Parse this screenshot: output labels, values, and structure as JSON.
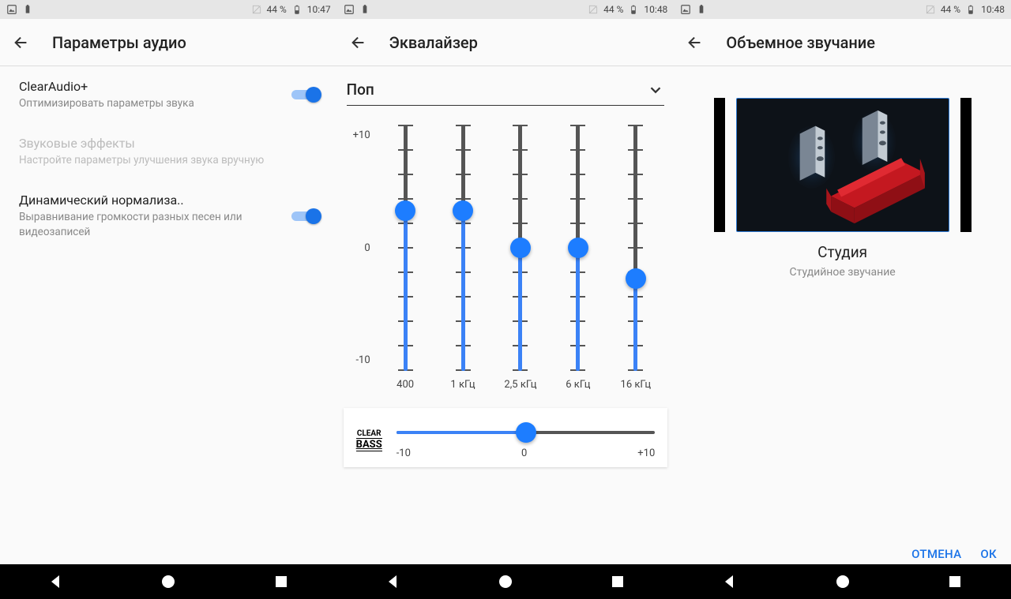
{
  "status": {
    "battery": "44 %",
    "time1": "10:47",
    "time2": "10:48",
    "time3": "10:48"
  },
  "pane1": {
    "title": "Параметры аудио",
    "items": [
      {
        "title": "ClearAudio+",
        "sub": "Оптимизировать параметры звука",
        "switch": true,
        "disabled": false
      },
      {
        "title": "Звуковые эффекты",
        "sub": "Настройте параметры улучшения звука вручную",
        "switch": false,
        "disabled": true
      },
      {
        "title": "Динамический нормализа..",
        "sub": "Выравнивание громкости разных песен или видеозаписей",
        "switch": true,
        "disabled": false
      }
    ]
  },
  "pane2": {
    "title": "Эквалайзер",
    "preset": "Поп",
    "scale": {
      "max": "+10",
      "mid": "0",
      "min": "-10"
    },
    "bands": [
      {
        "freq": "400",
        "value": 3
      },
      {
        "freq": "1 кГц",
        "value": 3
      },
      {
        "freq": "2,5 кГц",
        "value": 0
      },
      {
        "freq": "6 кГц",
        "value": 0
      },
      {
        "freq": "16 кГц",
        "value": -2.5
      }
    ],
    "bass": {
      "label_top": "CLEAR",
      "label_bot": "BASS",
      "value": 0,
      "min": "-10",
      "mid": "0",
      "max": "+10"
    }
  },
  "pane3": {
    "title": "Объемное звучание",
    "option": {
      "name": "Студия",
      "sub": "Студийное звучание"
    },
    "buttons": {
      "cancel": "ОТМЕНА",
      "ok": "ОК"
    }
  }
}
